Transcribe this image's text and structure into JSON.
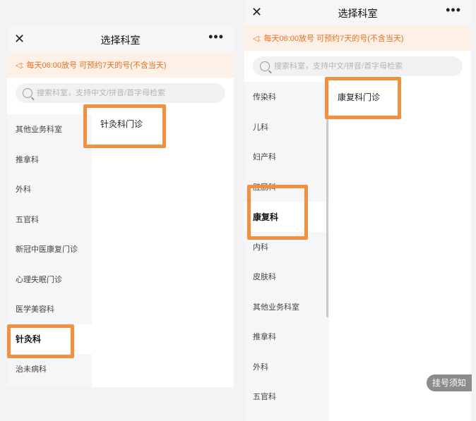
{
  "left": {
    "title": "选择科室",
    "close_icon": "close-icon",
    "more_icon": "more-icon",
    "notice": "每天06:00放号 可预约7天的号(不含当天)",
    "search_placeholder": "搜索科室，支持中文/拼音/首字母检索",
    "departments": [
      {
        "label": "其他业务科室"
      },
      {
        "label": "推拿科"
      },
      {
        "label": "外科"
      },
      {
        "label": "五官科"
      },
      {
        "label": "新冠中医康复门诊"
      },
      {
        "label": "心理失眠门诊"
      },
      {
        "label": "医学美容科"
      },
      {
        "label": "针灸科",
        "selected": true
      },
      {
        "label": "治未病科"
      }
    ],
    "clinics": [
      {
        "label": "针灸科门诊"
      }
    ]
  },
  "right": {
    "title": "选择科室",
    "close_icon": "close-icon",
    "more_icon": "more-icon",
    "notice": "每天06:00放号 可预约7天的号(不含当天)",
    "search_placeholder": "搜索科室，支持中文/拼音/首字母检索",
    "departments": [
      {
        "label": "传染科"
      },
      {
        "label": "儿科"
      },
      {
        "label": "妇产科"
      },
      {
        "label": "肛肠科"
      },
      {
        "label": "康复科",
        "selected": true
      },
      {
        "label": "内科"
      },
      {
        "label": "皮肤科"
      },
      {
        "label": "其他业务科室"
      },
      {
        "label": "推拿科"
      },
      {
        "label": "外科"
      },
      {
        "label": "五官科"
      }
    ],
    "clinics": [
      {
        "label": "康复科门诊"
      }
    ],
    "floating_tip": "挂号须知"
  },
  "colors": {
    "accent_orange": "#f0913f",
    "notice_text": "#e8701c",
    "notice_bg": "#fdf1e7"
  }
}
